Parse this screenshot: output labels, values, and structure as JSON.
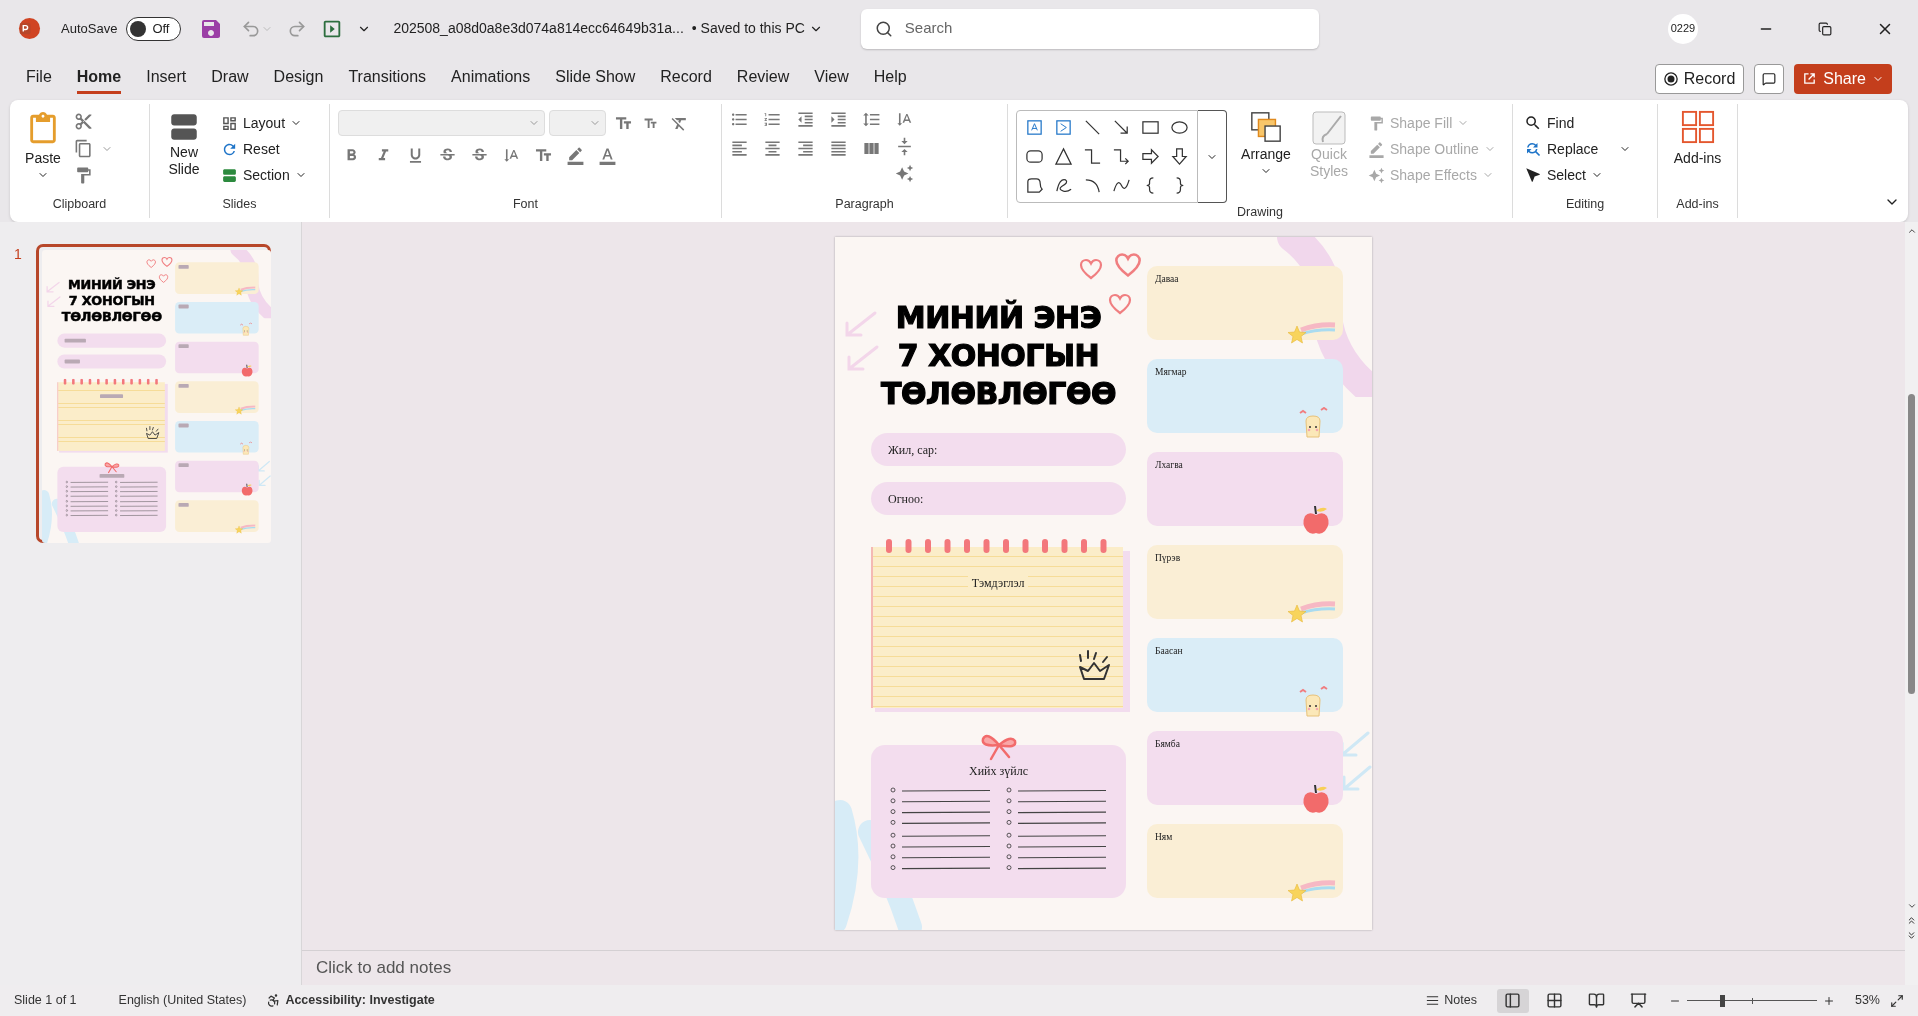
{
  "title_bar": {
    "autosave": "AutoSave",
    "autosave_toggle": {
      "label": "Off",
      "on": false
    },
    "file_name": "202508_a08d0a8e3d074a814ecc64649b31a...",
    "save_status": "• Saved to this PC",
    "search": {
      "placeholder": "Search"
    },
    "user": "0229"
  },
  "menu_tabs": [
    {
      "label": "File",
      "selected": false
    },
    {
      "label": "Home",
      "selected": true
    },
    {
      "label": "Insert",
      "selected": false
    },
    {
      "label": "Draw",
      "selected": false
    },
    {
      "label": "Design",
      "selected": false
    },
    {
      "label": "Transitions",
      "selected": false
    },
    {
      "label": "Animations",
      "selected": false
    },
    {
      "label": "Slide Show",
      "selected": false
    },
    {
      "label": "Record",
      "selected": false
    },
    {
      "label": "Review",
      "selected": false
    },
    {
      "label": "View",
      "selected": false
    },
    {
      "label": "Help",
      "selected": false
    }
  ],
  "record_button": "Record",
  "share_button": "Share",
  "ribbon": {
    "clipboard": {
      "label": "Clipboard",
      "paste": "Paste"
    },
    "slides": {
      "label": "Slides",
      "new_slide": "New Slide",
      "buttons": [
        "Layout",
        "Reset",
        "Section"
      ]
    },
    "font": {
      "label": "Font"
    },
    "paragraph": {
      "label": "Paragraph"
    },
    "drawing": {
      "label": "Drawing",
      "arrange": "Arrange",
      "quick_styles": {
        "label": "Quick Styles",
        "disabled": true
      },
      "format_buttons": [
        {
          "label": "Shape Fill",
          "disabled": true
        },
        {
          "label": "Shape Outline",
          "disabled": true
        },
        {
          "label": "Shape Effects",
          "disabled": true
        }
      ]
    },
    "editing": {
      "label": "Editing",
      "buttons": [
        "Find",
        "Replace",
        "Select"
      ]
    },
    "addins": {
      "label": "Add-ins",
      "button": "Add-ins"
    }
  },
  "slide_pane": {
    "number": "1",
    "selected": true
  },
  "thumbnail": {
    "title_lines": [
      "МИНИЙ ЭНЭ",
      "7 ХОНОГЫН",
      "ТӨЛӨВЛӨГӨӨ"
    ],
    "days": [
      {
        "color": "#faeed5",
        "kind": "star"
      },
      {
        "color": "#daedf7",
        "kind": "toast"
      },
      {
        "color": "#f3ddee",
        "kind": "apple"
      },
      {
        "color": "#faeed5",
        "kind": "star"
      },
      {
        "color": "#daedf7",
        "kind": "toast"
      },
      {
        "color": "#f3ddee",
        "kind": "apple"
      },
      {
        "color": "#faeed5",
        "kind": "star"
      }
    ]
  },
  "slide": {
    "title_lines": [
      "МИНИЙ ЭНЭ",
      "7 ХОНОГЫН",
      "ТӨЛӨВЛӨГӨӨ"
    ],
    "fields": [
      "Жил, сар:",
      "Огноо:"
    ],
    "notes_title": "Тэмдэглэл",
    "todo_title": "Хийх зүйлс",
    "days": [
      {
        "name": "Даваа",
        "color": "#faeed5",
        "kind": "star"
      },
      {
        "name": "Мягмар",
        "color": "#daedf7",
        "kind": "toast"
      },
      {
        "name": "Лхагва",
        "color": "#f3ddee",
        "kind": "apple"
      },
      {
        "name": "Пүрэв",
        "color": "#faeed5",
        "kind": "star"
      },
      {
        "name": "Баасан",
        "color": "#daedf7",
        "kind": "toast"
      },
      {
        "name": "Бямба",
        "color": "#f3ddee",
        "kind": "apple"
      },
      {
        "name": "Ням",
        "color": "#faeed5",
        "kind": "star"
      }
    ]
  },
  "notes": {
    "placeholder": "Click to add notes"
  },
  "status_bar": {
    "slide_count": "Slide 1 of 1",
    "language": "English (United States)",
    "accessibility": "Accessibility: Investigate",
    "notes_button": "Notes",
    "views": [
      {
        "kind": "normal",
        "selected": true
      },
      {
        "kind": "sorter",
        "selected": false
      },
      {
        "kind": "reading",
        "selected": false
      },
      {
        "kind": "slideshow",
        "selected": false
      }
    ],
    "zoom": {
      "level": 0.27,
      "reading": "53%"
    }
  }
}
